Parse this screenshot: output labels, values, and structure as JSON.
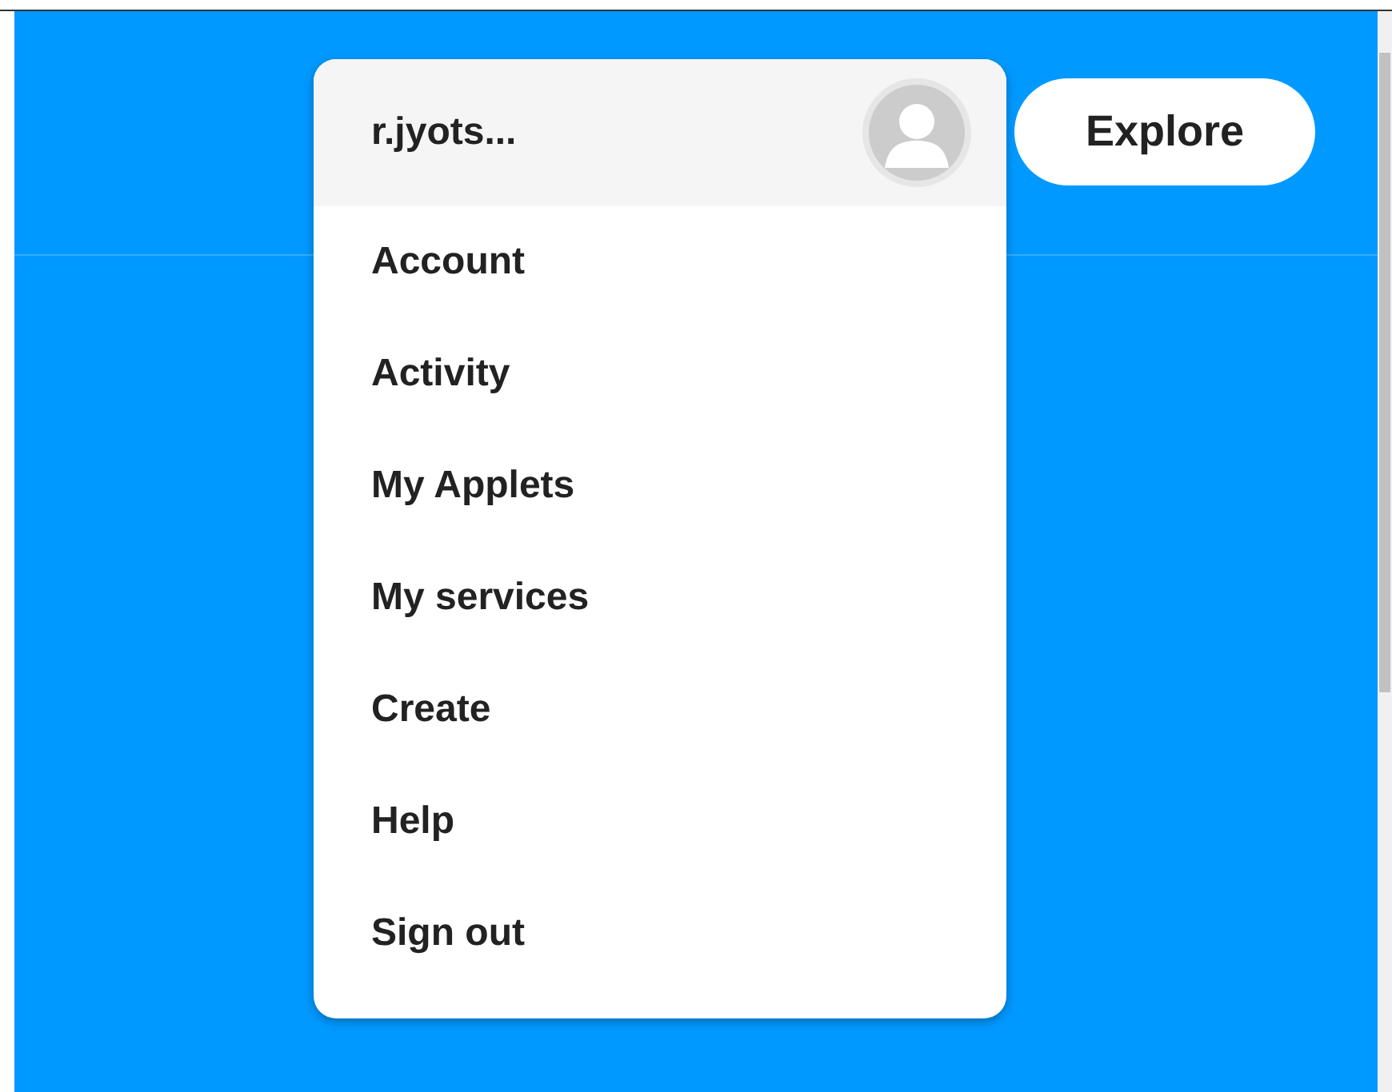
{
  "account_menu": {
    "username": "r.jyots...",
    "items": [
      {
        "label": "Account"
      },
      {
        "label": "Activity"
      },
      {
        "label": "My Applets"
      },
      {
        "label": "My services"
      },
      {
        "label": "Create"
      },
      {
        "label": "Help"
      },
      {
        "label": "Sign out"
      }
    ]
  },
  "explore_button": {
    "label": "Explore"
  }
}
